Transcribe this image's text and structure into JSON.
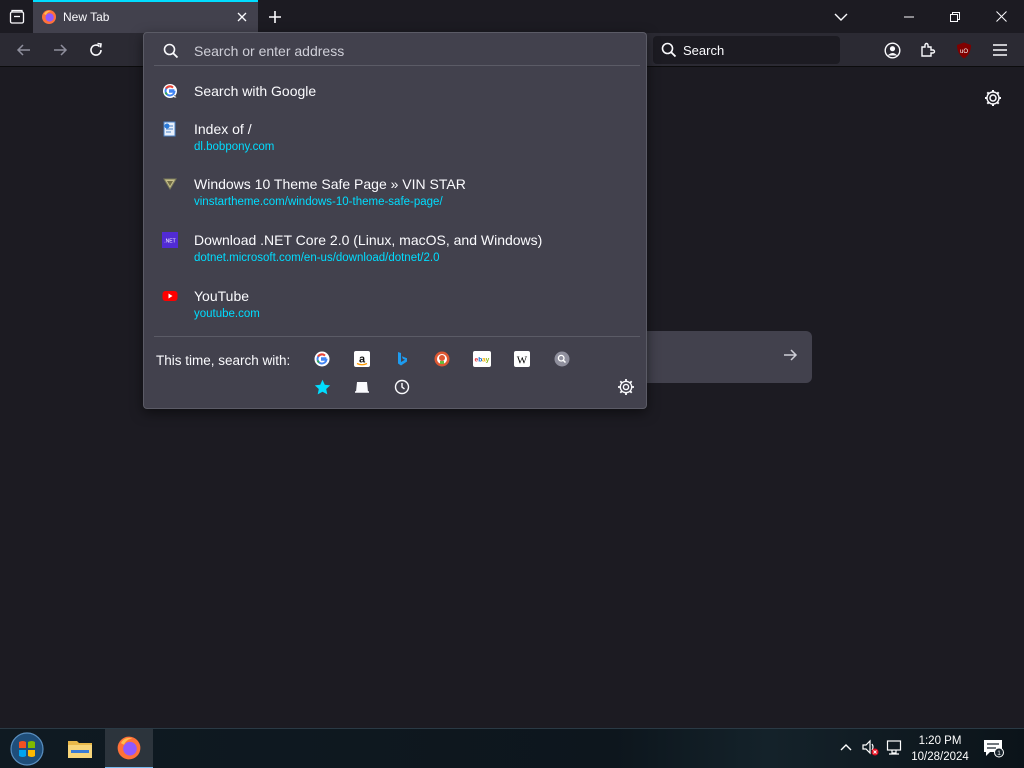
{
  "tabs": [
    {
      "label": "New Tab",
      "active": true
    }
  ],
  "navbar": {
    "search_placeholder": "Search"
  },
  "urlbar": {
    "placeholder": "Search or enter address",
    "value": ""
  },
  "results": [
    {
      "title": "Search with Google",
      "url": "",
      "icon": "google-icon"
    },
    {
      "title": "Index of /",
      "url": "dl.bobpony.com",
      "icon": "page-icon"
    },
    {
      "title": "Windows 10 Theme Safe Page » VIN STAR",
      "url": "vinstartheme.com/windows-10-theme-safe-page/",
      "icon": "vinstar-icon"
    },
    {
      "title": "Download .NET Core 2.0 (Linux, macOS, and Windows)",
      "url": "dotnet.microsoft.com/en-us/download/dotnet/2.0",
      "icon": "dotnet-icon"
    },
    {
      "title": "YouTube",
      "url": "youtube.com",
      "icon": "youtube-icon"
    }
  ],
  "one_off": {
    "label": "This time, search with:",
    "engines": [
      "google-icon",
      "amazon-icon",
      "bing-icon",
      "duckduckgo-icon",
      "ebay-icon",
      "wikipedia-icon",
      "search-engine-icon"
    ],
    "modes": [
      "bookmarks-icon",
      "tabs-icon",
      "history-icon"
    ]
  },
  "taskbar": {
    "time": "1:20 PM",
    "date": "10/28/2024",
    "notification_count": "1"
  },
  "colors": {
    "accent": "#00ddff",
    "url_text": "#00ddff",
    "tab_bg": "#42414d",
    "page_bg": "#1c1b22"
  }
}
